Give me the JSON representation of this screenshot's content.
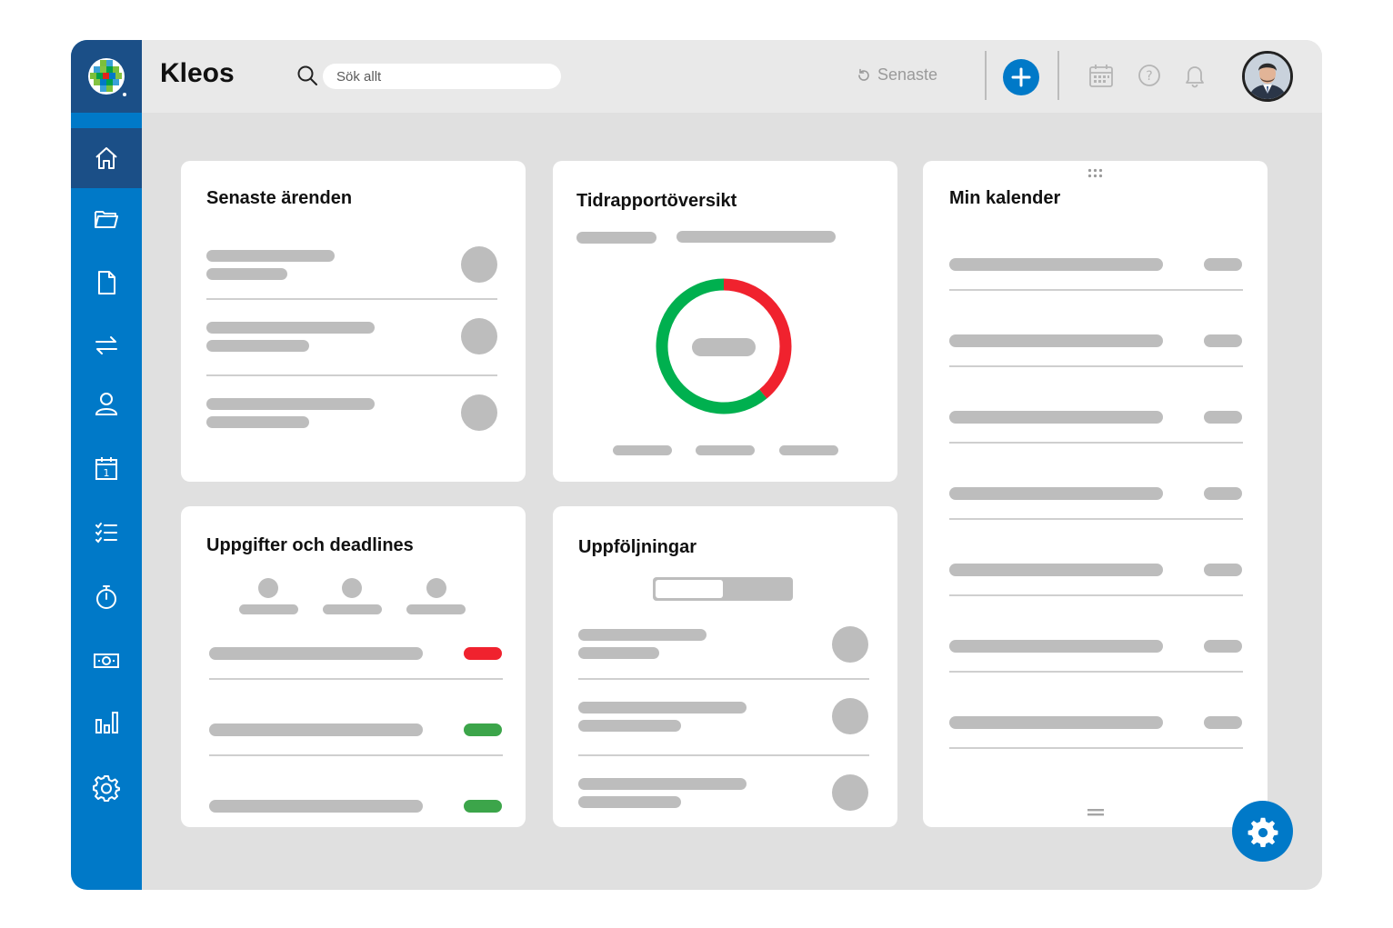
{
  "app": {
    "name": "Kleos"
  },
  "header": {
    "search_placeholder": "Sök allt",
    "recent_label": "Senaste"
  },
  "sidebar": {
    "items": [
      {
        "icon": "home-icon",
        "active": true
      },
      {
        "icon": "folder-icon",
        "active": false
      },
      {
        "icon": "document-icon",
        "active": false
      },
      {
        "icon": "transfer-icon",
        "active": false
      },
      {
        "icon": "user-icon",
        "active": false
      },
      {
        "icon": "calendar-icon",
        "active": false
      },
      {
        "icon": "checklist-icon",
        "active": false
      },
      {
        "icon": "stopwatch-icon",
        "active": false
      },
      {
        "icon": "money-icon",
        "active": false
      },
      {
        "icon": "bar-chart-icon",
        "active": false
      },
      {
        "icon": "gear-icon",
        "active": false
      }
    ]
  },
  "cards": {
    "recent_cases": {
      "title": "Senaste ärenden"
    },
    "time_report": {
      "title": "Tidrapportöversikt",
      "donut": {
        "green_fraction": 0.61,
        "red_fraction": 0.39
      }
    },
    "calendar": {
      "title": "Min kalender"
    },
    "tasks": {
      "title": "Uppgifter och deadlines",
      "statuses": [
        "red",
        "green",
        "green"
      ]
    },
    "followups": {
      "title": "Uppföljningar"
    }
  },
  "colors": {
    "primary": "#0079c8",
    "primary_dark": "#1b4f87",
    "status_red": "#f0222e",
    "status_green": "#3ca54a",
    "donut_green": "#00b04f",
    "placeholder": "#bdbdbd"
  }
}
